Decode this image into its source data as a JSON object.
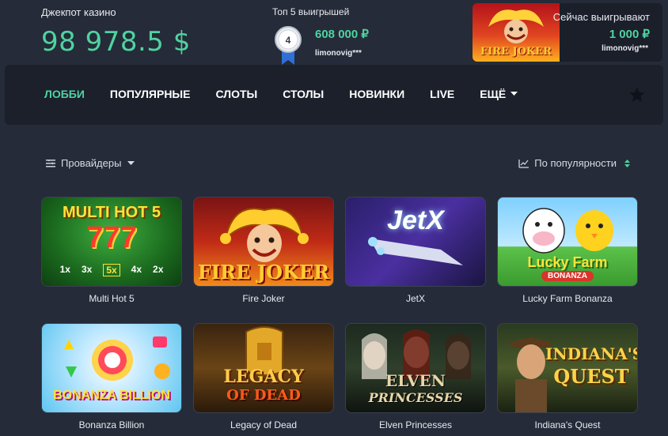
{
  "jackpot": {
    "label": "Джекпот казино",
    "value": "98 978.5 $"
  },
  "top5": {
    "label": "Топ 5 выигрышей",
    "rank": "4",
    "amount": "608 000 ₽",
    "user": "limonovig***"
  },
  "now_winning": {
    "label": "Сейчас выигрывают",
    "amount": "1 000 ₽",
    "user": "limonovig***",
    "game_logo": "FIRE JOKER"
  },
  "nav": {
    "items": [
      "ЛОББИ",
      "ПОПУЛЯРНЫЕ",
      "СЛОТЫ",
      "СТОЛЫ",
      "НОВИНКИ",
      "LIVE"
    ],
    "more_label": "ЕЩЁ",
    "active_index": 0,
    "favorites_icon": "star-icon"
  },
  "filters": {
    "providers_label": "Провайдеры",
    "sort_label": "По популярности"
  },
  "games": [
    {
      "title": "Multi Hot 5",
      "logo": "MULTI HOT 5",
      "multipliers": [
        "1x",
        "3x",
        "5x",
        "4x",
        "2x"
      ]
    },
    {
      "title": "Fire Joker",
      "logo": "FIRE JOKER"
    },
    {
      "title": "JetX",
      "logo": "JetX"
    },
    {
      "title": "Lucky Farm Bonanza",
      "logo": "Lucky Farm",
      "logo_sub": "BONANZA"
    },
    {
      "title": "Bonanza Billion",
      "logo": "BONANZA BILLION"
    },
    {
      "title": "Legacy of Dead",
      "logo": "LEGACY",
      "logo_sub": "OF DEAD"
    },
    {
      "title": "Elven Princesses",
      "logo": "ELVEN",
      "logo_sub": "PRINCESSES"
    },
    {
      "title": "Indiana's Quest",
      "logo": "INDIANA'S",
      "logo_sub": "QUEST"
    }
  ],
  "colors": {
    "accent": "#4fd3a0",
    "background": "#252b38",
    "nav_bg": "#1b202b"
  }
}
